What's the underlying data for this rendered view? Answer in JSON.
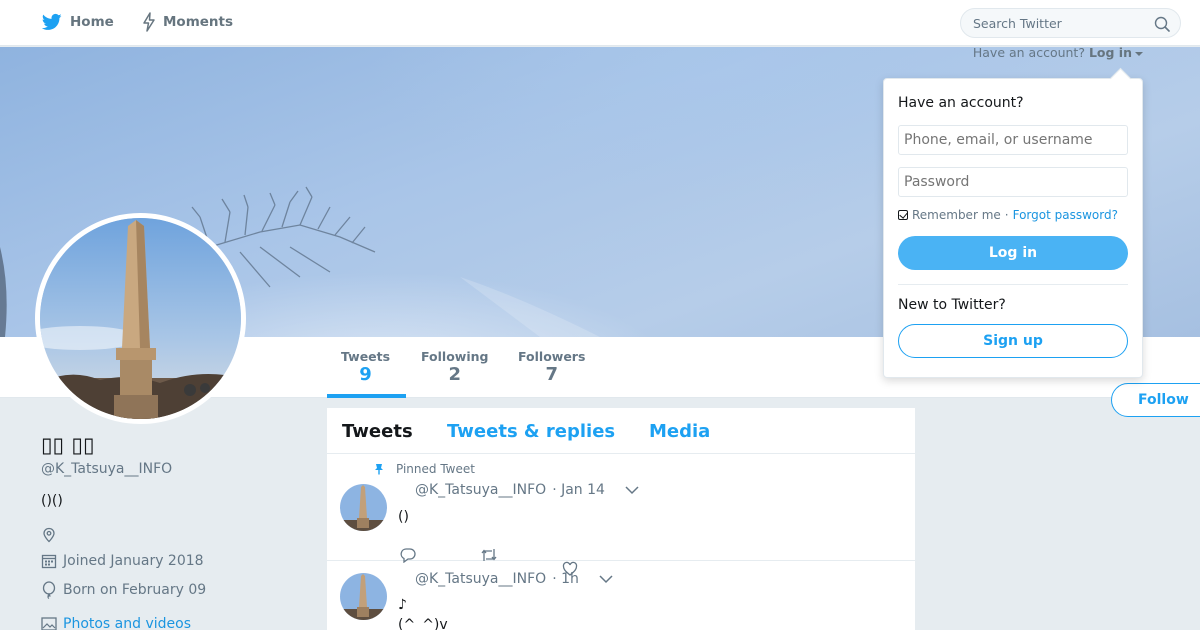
{
  "nav": {
    "home_label": "Home",
    "moments_label": "Moments",
    "search_placeholder": "Search Twitter"
  },
  "login_hint": {
    "prefix": "Have an account?",
    "link": "Log in"
  },
  "profile": {
    "name": "▯▯ ▯▯",
    "handle": "@K_Tatsuya__INFO",
    "bio": "()()",
    "location": "",
    "joined": "Joined January 2018",
    "born": "Born on February 09",
    "photos_link": "Photos and videos"
  },
  "stats": [
    {
      "label": "Tweets",
      "value": "9"
    },
    {
      "label": "Following",
      "value": "2"
    },
    {
      "label": "Followers",
      "value": "7"
    }
  ],
  "follow_label": "Follow",
  "timeline": {
    "tabs": [
      "Tweets",
      "Tweets & replies",
      "Media"
    ],
    "tweets": [
      {
        "pinned_label": "Pinned Tweet",
        "handle": "@K_Tatsuya__INFO",
        "time": "· Jan 14",
        "text": "()"
      },
      {
        "handle": "@K_Tatsuya__INFO",
        "time": "· 1h",
        "text_line1": "♪",
        "text_line2": "(^_^)v"
      }
    ]
  },
  "login_dropdown": {
    "title": "Have an account?",
    "username_placeholder": "Phone, email, or username",
    "password_placeholder": "Password",
    "remember_label": "Remember me",
    "separator": "·",
    "forgot_label": "Forgot password?",
    "login_button": "Log in",
    "new_label": "New to Twitter?",
    "signup_button": "Sign up"
  },
  "colors": {
    "accent": "#1da1f2",
    "login_button_bg": "#4ab3f4",
    "page_bg": "#e6ecf0"
  }
}
